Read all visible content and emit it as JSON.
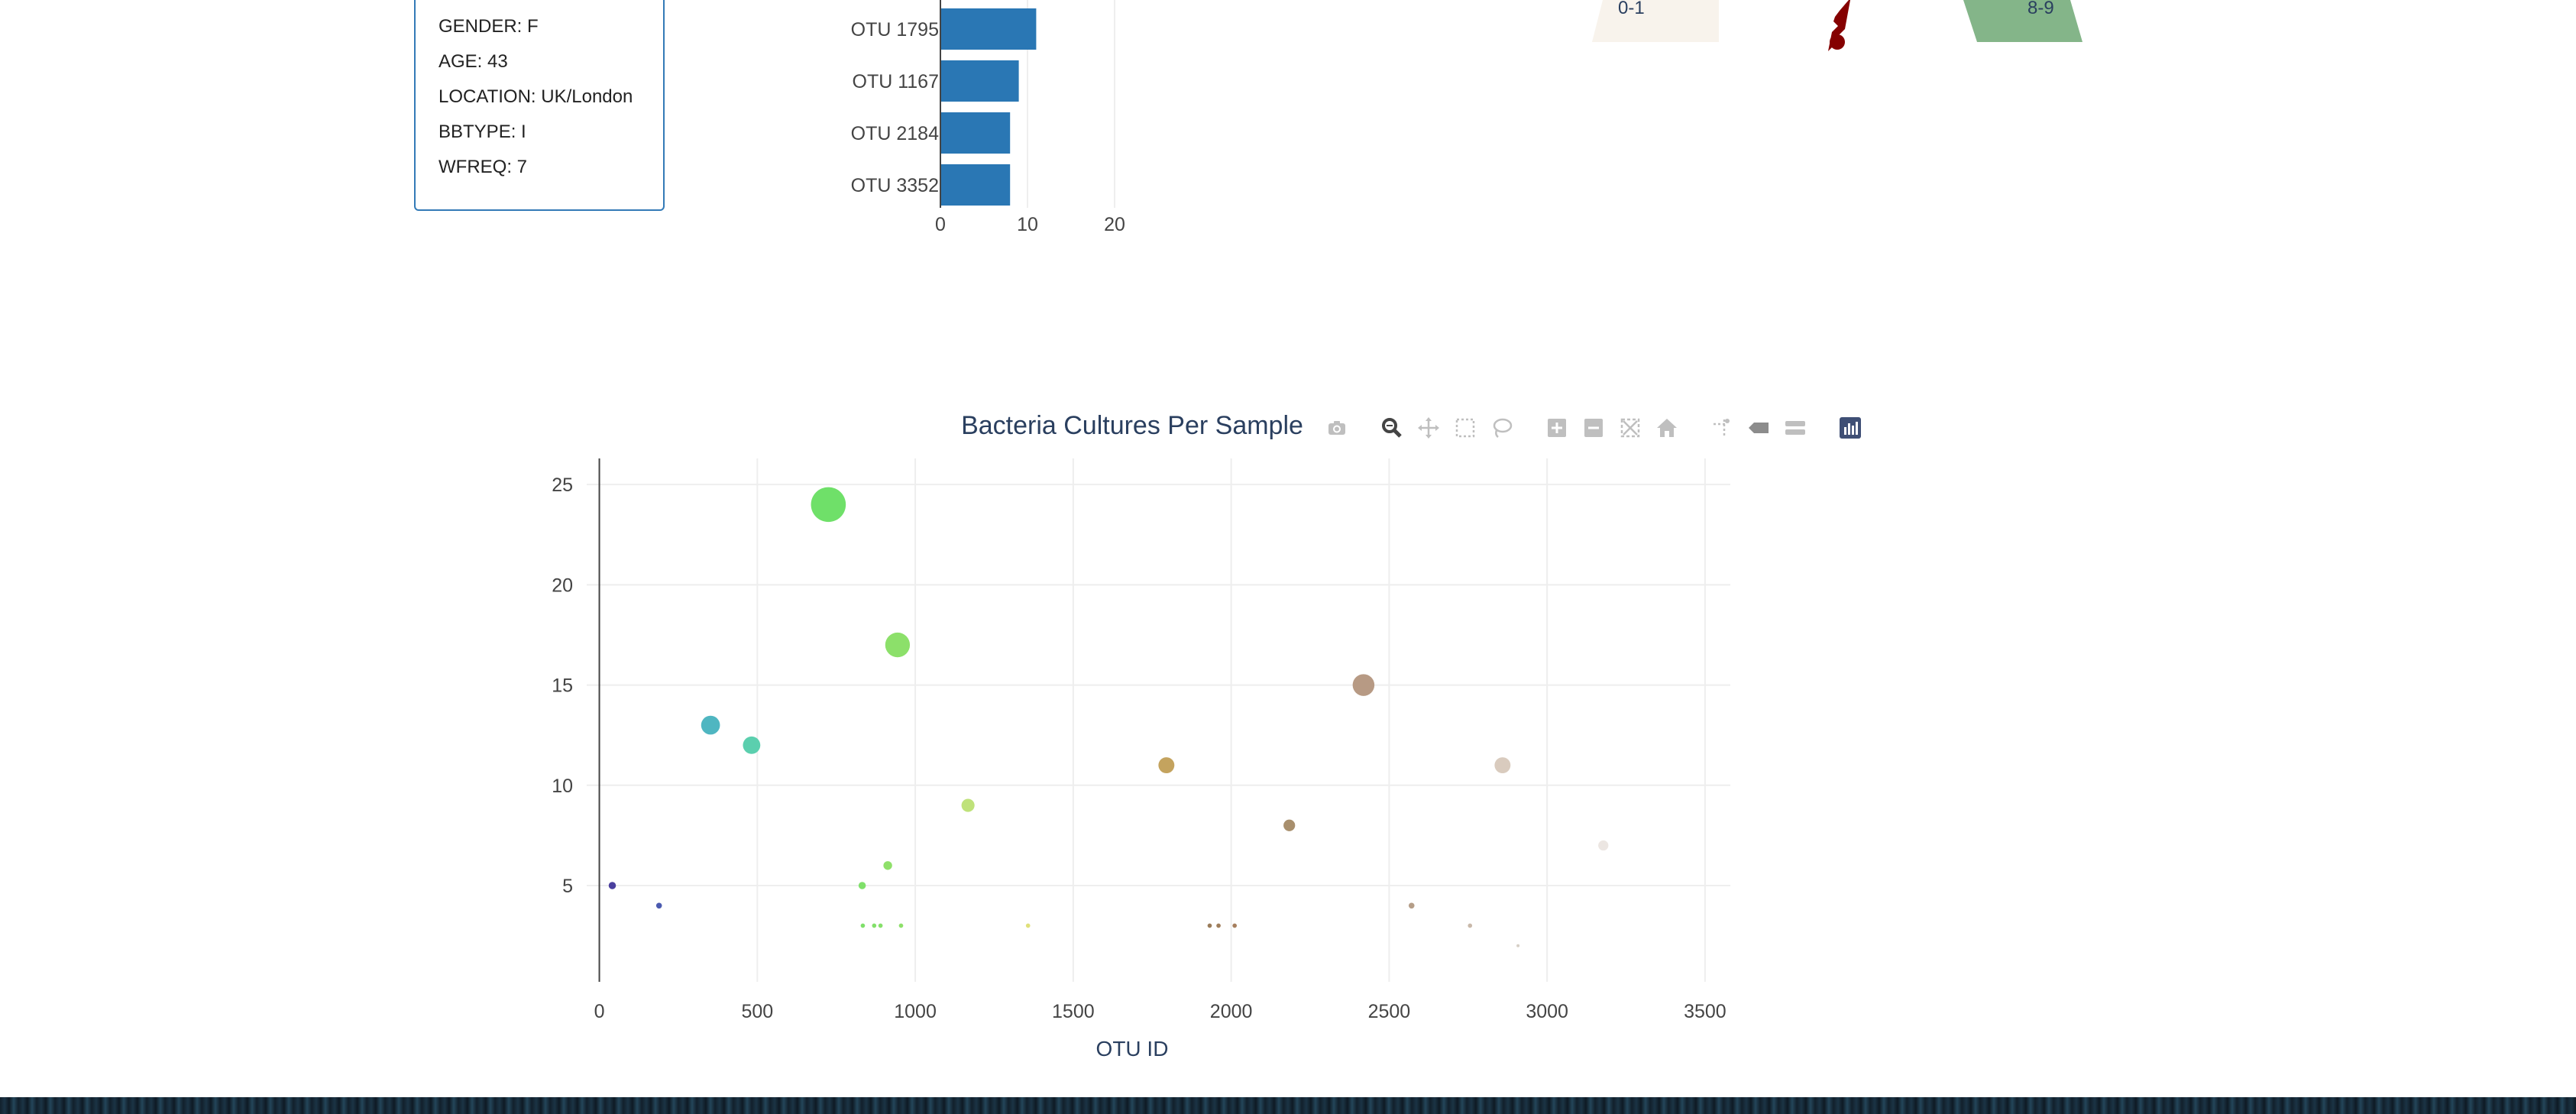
{
  "metadata": {
    "lines": [
      "GENDER: F",
      "AGE: 43",
      "LOCATION: UK/London",
      "BBTYPE: I",
      "WFREQ: 7"
    ]
  },
  "bar_chart": {
    "color": "#2a77b4",
    "categories": [
      "OTU 1795",
      "OTU 1167",
      "OTU 2184",
      "OTU 3352"
    ],
    "values": [
      11,
      9,
      8,
      8
    ],
    "x_ticks": [
      "0",
      "10",
      "20"
    ],
    "xlim": [
      0,
      21
    ]
  },
  "gauge": {
    "left_label": "0-1",
    "right_label": "8-9",
    "left_color": "#f8f3ec",
    "right_color": "#84b589",
    "needle_color": "#850000"
  },
  "chart_data": {
    "type": "scatter",
    "title": "Bacteria Cultures Per Sample",
    "xlabel": "OTU ID",
    "ylabel": "",
    "xlim": [
      -40,
      3580
    ],
    "ylim": [
      0.2,
      26.3
    ],
    "x_ticks": [
      0,
      500,
      1000,
      1500,
      2000,
      2500,
      3000,
      3500
    ],
    "y_ticks": [
      5,
      10,
      15,
      20,
      25
    ],
    "grid": true,
    "series": [
      {
        "x": [
          41,
          189,
          352,
          482,
          725,
          944,
          1167,
          1795,
          2184,
          2419,
          2859,
          3178,
          832,
          913,
          2571,
          2756,
          834,
          870,
          890,
          955,
          1357,
          1932,
          1960,
          2011,
          2908
        ],
        "y": [
          5,
          4,
          13,
          12,
          24,
          17,
          9,
          11,
          8,
          15,
          11,
          7,
          5,
          6,
          4,
          3,
          3,
          3,
          3,
          3,
          3,
          3,
          3,
          3,
          2
        ],
        "colors": [
          "#4a3f9e",
          "#4b5bb0",
          "#4fb6c1",
          "#5bcfae",
          "#6fe069",
          "#8ce06a",
          "#bfe27a",
          "#c4a35e",
          "#a88f6d",
          "#b79a84",
          "#d9cbbe",
          "#ece6e2",
          "#7fe06a",
          "#8fe06a",
          "#b59e88",
          "#c9b9aa",
          "#7fe06a",
          "#83e06a",
          "#86e06a",
          "#8ee06a",
          "#e0e07a",
          "#9a7c5a",
          "#a07e5c",
          "#a67f5e",
          "#d6cfc6"
        ]
      }
    ]
  },
  "modebar": {
    "icons": [
      "camera-icon",
      "zoom-icon",
      "pan-icon",
      "box-select-icon",
      "lasso-select-icon",
      "zoom-in-icon",
      "zoom-out-icon",
      "autoscale-icon",
      "reset-axes-icon",
      "spike-lines-icon",
      "hover-closest-icon",
      "hover-compare-icon",
      "plotly-logo-icon"
    ]
  }
}
